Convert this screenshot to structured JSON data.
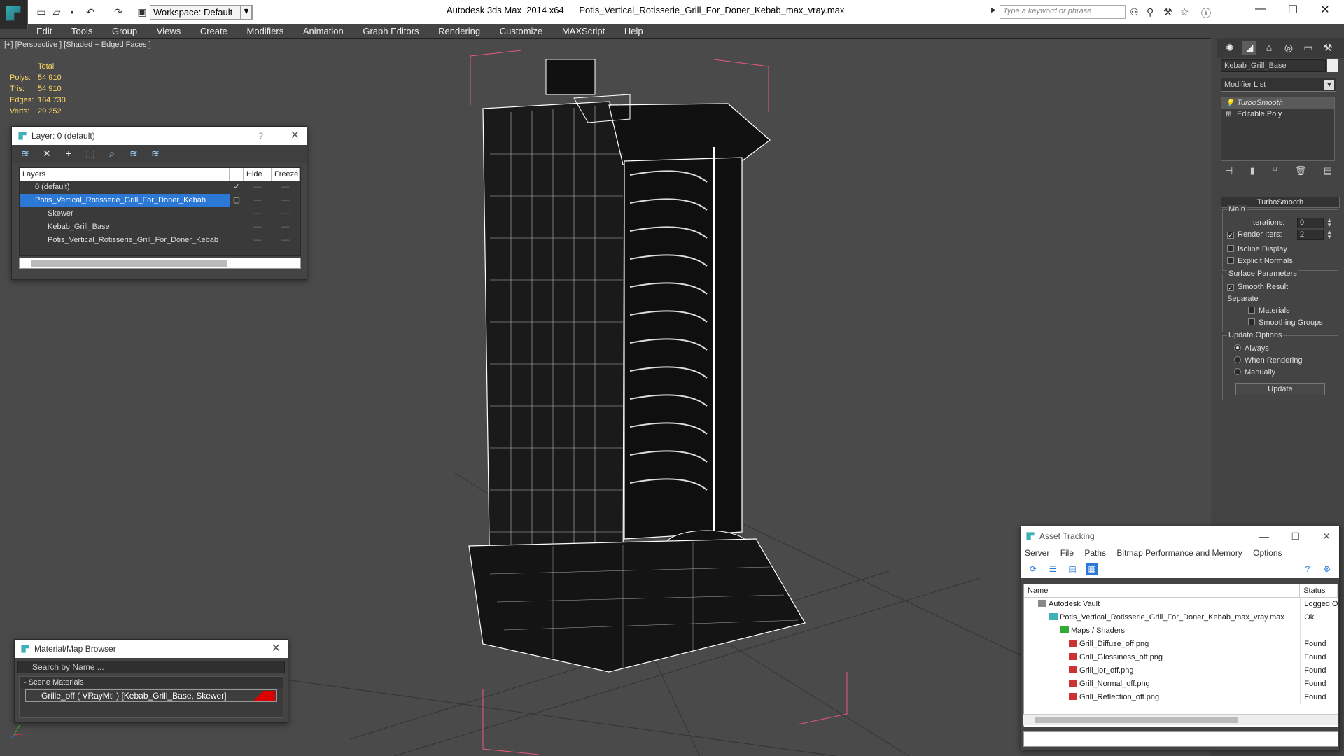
{
  "app": {
    "title": "Autodesk 3ds Max  2014 x64      Potis_Vertical_Rotisserie_Grill_For_Doner_Kebab_max_vray.max",
    "workspace": "Workspace: Default",
    "search_placeholder": "Type a keyword or phrase"
  },
  "menu": [
    "Edit",
    "Tools",
    "Group",
    "Views",
    "Create",
    "Modifiers",
    "Animation",
    "Graph Editors",
    "Rendering",
    "Customize",
    "MAXScript",
    "Help"
  ],
  "viewport": {
    "label": "[+] [Perspective ] [Shaded + Edged Faces ]",
    "stats": {
      "header": "Total",
      "rows": [
        {
          "k": "Polys:",
          "v": "54 910"
        },
        {
          "k": "Tris:",
          "v": "54 910"
        },
        {
          "k": "Edges:",
          "v": "164 730"
        },
        {
          "k": "Verts:",
          "v": "29 252"
        }
      ]
    }
  },
  "layer_panel": {
    "title": "Layer: 0 (default)",
    "help": "?",
    "columns": {
      "layers": "Layers",
      "hide": "Hide",
      "freeze": "Freeze"
    },
    "rows": [
      {
        "name": "0 (default)",
        "selected": false,
        "check": "✓"
      },
      {
        "name": "Potis_Vertical_Rotisserie_Grill_For_Doner_Kebab",
        "selected": true,
        "check": "▢"
      },
      {
        "name": "Skewer",
        "selected": false,
        "check": ""
      },
      {
        "name": "Kebab_Grill_Base",
        "selected": false,
        "check": ""
      },
      {
        "name": "Potis_Vertical_Rotisserie_Grill_For_Doner_Kebab",
        "selected": false,
        "check": ""
      }
    ]
  },
  "material_browser": {
    "title": "Material/Map Browser",
    "search_placeholder": "Search by Name ...",
    "category": "- Scene Materials",
    "material": "Grille_off  ( VRayMtl ) [Kebab_Grill_Base, Skewer]"
  },
  "command_panel": {
    "object_name": "Kebab_Grill_Base",
    "modifier_list": "Modifier List",
    "stack": [
      "TurboSmooth",
      "Editable Poly"
    ],
    "rollout_title": "TurboSmooth",
    "main_group": "Main",
    "iterations_label": "Iterations:",
    "iterations_value": "0",
    "render_iters_label": "Render Iters:",
    "render_iters_value": "2",
    "isoline": "Isoline Display",
    "explicit_normals": "Explicit Normals",
    "surface_group": "Surface Parameters",
    "smooth_result": "Smooth Result",
    "separate": "Separate",
    "materials": "Materials",
    "smoothing_groups": "Smoothing Groups",
    "update_group": "Update Options",
    "always": "Always",
    "when_rendering": "When Rendering",
    "manually": "Manually",
    "update_button": "Update"
  },
  "asset_tracking": {
    "title": "Asset Tracking",
    "menu": [
      "Server",
      "File",
      "Paths",
      "Bitmap Performance and Memory",
      "Options"
    ],
    "columns": {
      "name": "Name",
      "status": "Status"
    },
    "rows": [
      {
        "name": "Autodesk Vault",
        "status": "Logged Or",
        "indent": 1,
        "icon": "vault"
      },
      {
        "name": "Potis_Vertical_Rotisserie_Grill_For_Doner_Kebab_max_vray.max",
        "status": "Ok",
        "indent": 2,
        "icon": "max"
      },
      {
        "name": "Maps / Shaders",
        "status": "",
        "indent": 3,
        "icon": "folder"
      },
      {
        "name": "Grill_Diffuse_off.png",
        "status": "Found",
        "indent": 4,
        "icon": "png"
      },
      {
        "name": "Grill_Glossiness_off.png",
        "status": "Found",
        "indent": 4,
        "icon": "png"
      },
      {
        "name": "Grill_ior_off.png",
        "status": "Found",
        "indent": 4,
        "icon": "png"
      },
      {
        "name": "Grill_Normal_off.png",
        "status": "Found",
        "indent": 4,
        "icon": "png"
      },
      {
        "name": "Grill_Reflection_off.png",
        "status": "Found",
        "indent": 4,
        "icon": "png"
      }
    ]
  }
}
